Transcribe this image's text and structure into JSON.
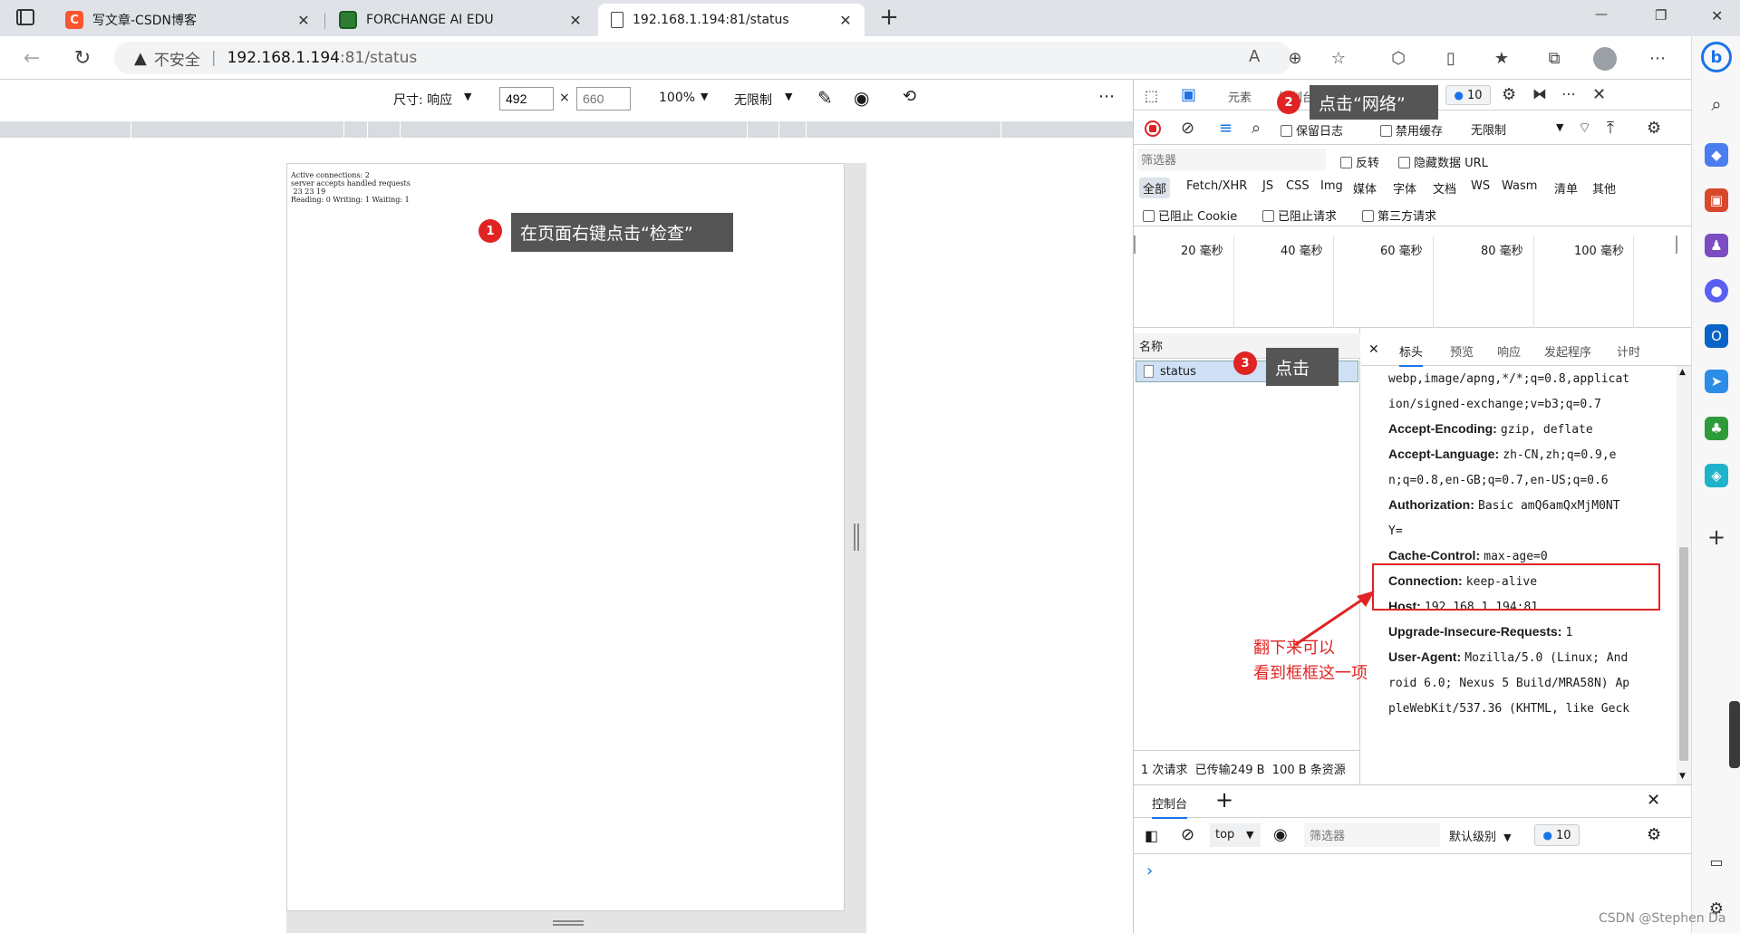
{
  "tabs": [
    {
      "title": "写文章-CSDN博客",
      "icon": "csdn-icon"
    },
    {
      "title": "FORCHANGE AI EDU",
      "icon": "forchange-icon"
    },
    {
      "title": "192.168.1.194:81/status",
      "icon": "page-icon"
    }
  ],
  "window": {
    "minimize": "—",
    "maximize": "❐",
    "close": "✕"
  },
  "address": {
    "security_label": "不安全",
    "host": "192.168.1.194",
    "path": ":81/status"
  },
  "device_toolbar": {
    "size_label": "尺寸: 响应",
    "width": "492",
    "height_placeholder": "660",
    "times": "×",
    "zoom": "100%",
    "throttle": "无限制"
  },
  "page": {
    "lines": [
      "Active connections: 2",
      "server accepts handled requests",
      " 23 23 19",
      "Reading: 0 Writing: 1 Waiting: 1"
    ]
  },
  "annotations": {
    "step1": {
      "num": "1",
      "text": "在页面右键点击“检查”"
    },
    "step2": {
      "num": "2",
      "text": "点击“网络”"
    },
    "step3": {
      "num": "3",
      "text": "点击"
    },
    "note": "翻下来可以\n看到框框这一项",
    "accent": "#e02424"
  },
  "devtools": {
    "tabs": {
      "elements": "元素",
      "console": "控制台",
      "network": "网络"
    },
    "issues_count": "10",
    "network_toolbar": {
      "preserve_log": "保留日志",
      "disable_cache": "禁用缓存",
      "throttle": "无限制"
    },
    "filter": {
      "placeholder": "筛选器",
      "invert": "反转",
      "hide_data_urls": "隐藏数据 URL"
    },
    "type_filters": [
      "全部",
      "Fetch/XHR",
      "JS",
      "CSS",
      "Img",
      "媒体",
      "字体",
      "文档",
      "WS",
      "Wasm",
      "清单",
      "其他"
    ],
    "checkboxes": {
      "blocked_cookies": "已阻止 Cookie",
      "blocked_requests": "已阻止请求",
      "third_party": "第三方请求"
    },
    "timeline_ticks": [
      "20 毫秒",
      "40 毫秒",
      "60 毫秒",
      "80 毫秒",
      "100 毫秒"
    ],
    "name_column": "名称",
    "request_name": "status",
    "summary": "1 次请求  已传输249 B  100 B 条资源",
    "detail_tabs": [
      "标头",
      "预览",
      "响应",
      "发起程序",
      "计时"
    ],
    "headers": [
      {
        "name": "",
        "value": "webp,image/apng,*/*;q=0.8,applicat"
      },
      {
        "name": "",
        "value": "ion/signed-exchange;v=b3;q=0.7"
      },
      {
        "name": "Accept-Encoding:",
        "value": "gzip, deflate"
      },
      {
        "name": "Accept-Language:",
        "value": "zh-CN,zh;q=0.9,e"
      },
      {
        "name": "",
        "value": "n;q=0.8,en-GB;q=0.7,en-US;q=0.6"
      },
      {
        "name": "Authorization:",
        "value": "Basic amQ6amQxMjM0NT"
      },
      {
        "name": "",
        "value": "Y="
      },
      {
        "name": "Cache-Control:",
        "value": "max-age=0"
      },
      {
        "name": "Connection:",
        "value": "keep-alive"
      },
      {
        "name": "Host:",
        "value": "192.168.1.194:81"
      },
      {
        "name": "Upgrade-Insecure-Requests:",
        "value": "1"
      },
      {
        "name": "User-Agent:",
        "value": "Mozilla/5.0 (Linux; And"
      },
      {
        "name": "",
        "value": "roid 6.0; Nexus 5 Build/MRA58N) Ap"
      },
      {
        "name": "",
        "value": "pleWebKit/537.36 (KHTML, like Geck"
      }
    ],
    "drawer": {
      "tab": "控制台",
      "context": "top",
      "filter_placeholder": "筛选器",
      "level": "默认级别",
      "issues_count": "10",
      "prompt": "›"
    }
  },
  "watermark": "CSDN @Stephen Da"
}
